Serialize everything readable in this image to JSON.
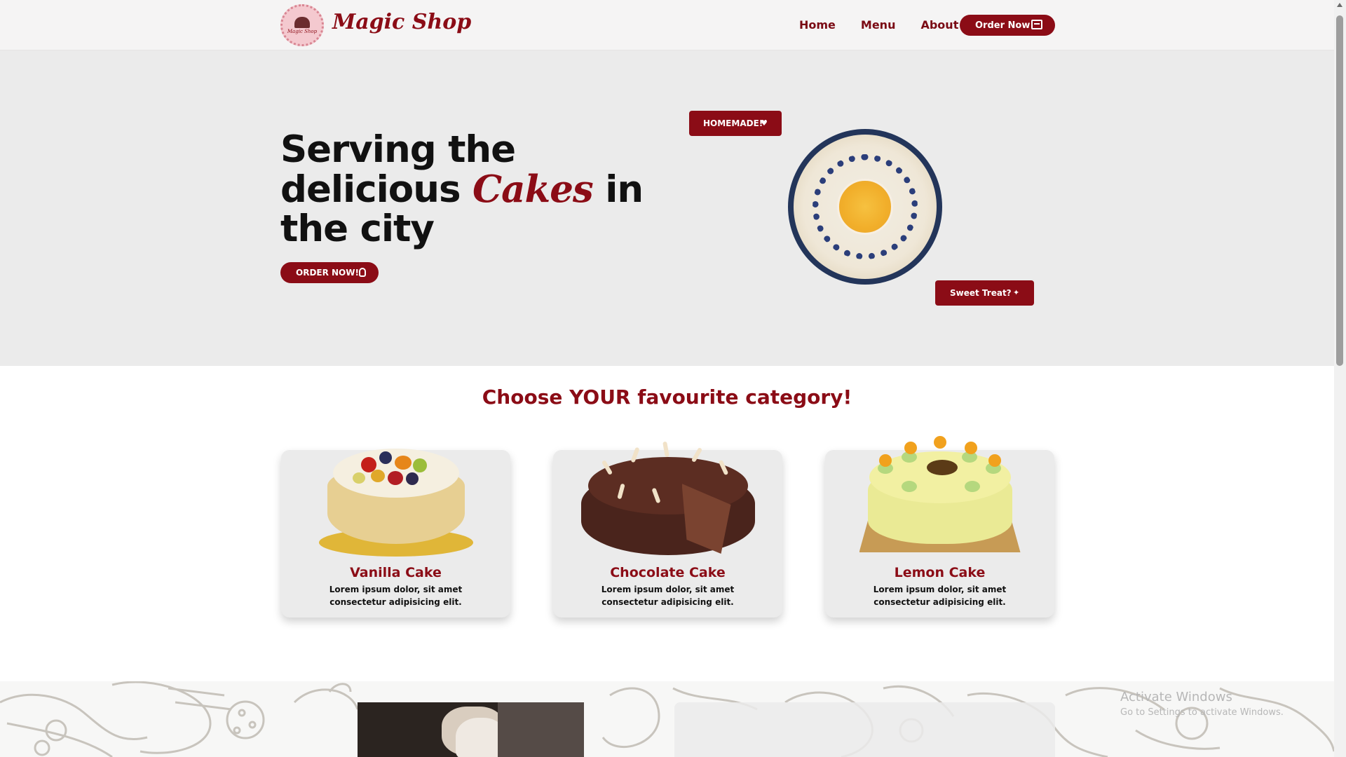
{
  "brand": {
    "name": "Magic Shop",
    "badge_text": "Magic Shop"
  },
  "nav": {
    "links": [
      "Home",
      "Menu",
      "About"
    ],
    "order_label": "Order Now",
    "order_icon": "calendar-icon"
  },
  "hero": {
    "title_line1": "Serving the",
    "title_line2_pre": "delicious ",
    "title_script": "Cakes",
    "title_line2_post": " in",
    "title_line3": "the city",
    "cta_label": "ORDER NOW!",
    "cta_icon": "hand-pointer-icon",
    "badge_homemade": "HOMEMADE!",
    "badge_homemade_icon": "heart-hands-icon",
    "badge_sweet": "Sweet Treat?",
    "badge_sweet_icon": "sparkle-icon"
  },
  "categories": {
    "title": "Choose YOUR favourite category!",
    "items": [
      {
        "name": "Vanilla Cake",
        "desc": "Lorem ipsum dolor, sit amet consectetur adipisicing elit."
      },
      {
        "name": "Chocolate Cake",
        "desc": "Lorem ipsum dolor, sit amet consectetur adipisicing elit."
      },
      {
        "name": "Lemon Cake",
        "desc": "Lorem ipsum dolor, sit amet consectetur adipisicing elit."
      }
    ]
  },
  "watermark": {
    "line1": "Activate Windows",
    "line2": "Go to Settings to activate Windows."
  },
  "colors": {
    "accent": "#8b0c16",
    "hero_bg": "#ebebeb",
    "nav_bg": "#f5f4f4"
  }
}
